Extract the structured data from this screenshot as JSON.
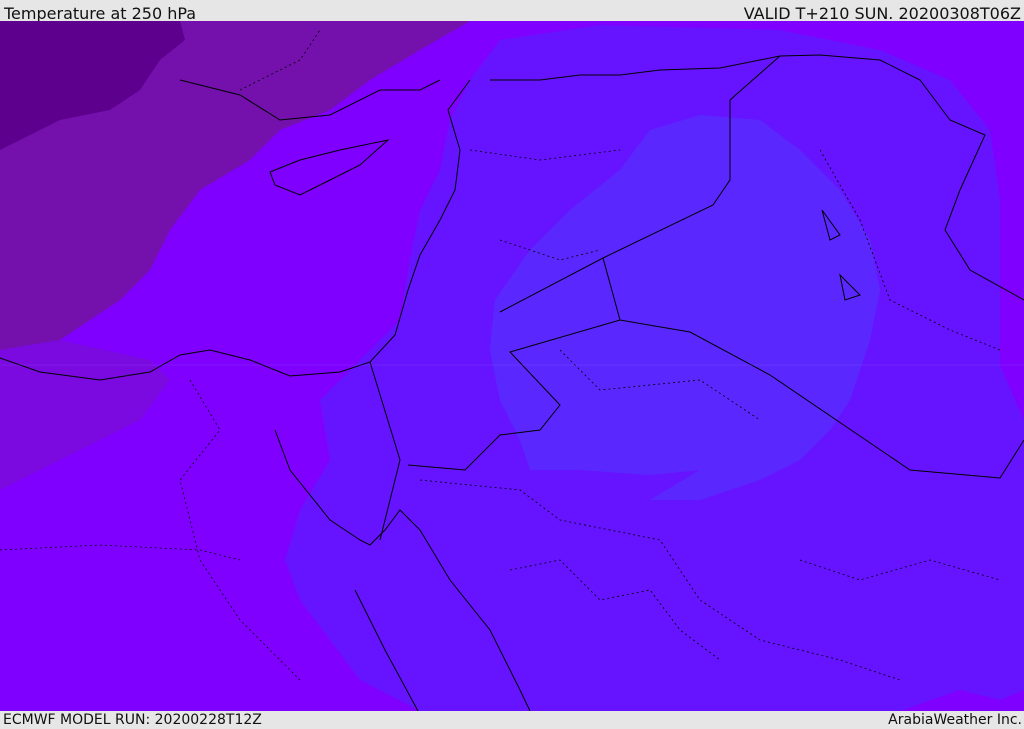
{
  "header": {
    "title": "Temperature at 250 hPa",
    "valid": "VALID T+210 SUN. 20200308T06Z"
  },
  "footer": {
    "model_run": "ECMWF MODEL RUN: 20200228T12Z",
    "credit": "ArabiaWeather Inc."
  },
  "colors": {
    "darkest": "#5e008e",
    "dark": "#7410ac",
    "main": "#8000ff",
    "medium": "#6614ff",
    "light": "#5a28ff",
    "lightest": "#5530ff"
  }
}
